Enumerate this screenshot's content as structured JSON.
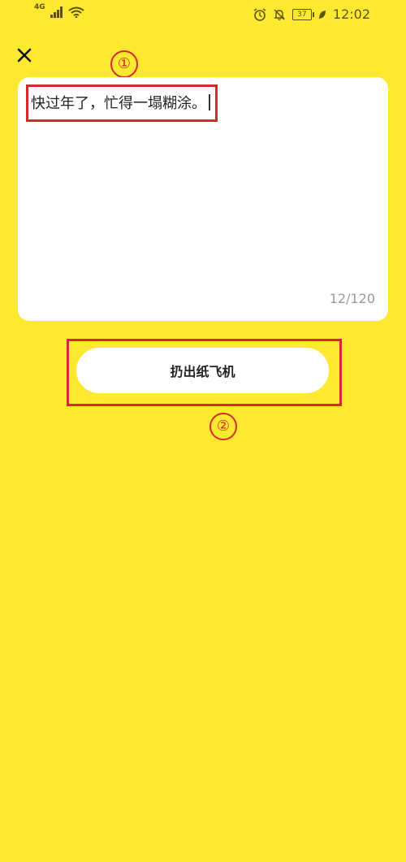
{
  "status_bar": {
    "network": "4G",
    "battery": "37",
    "time": "12:02"
  },
  "icons": {
    "close": "close-icon",
    "signal": "signal-icon",
    "wifi": "wifi-icon",
    "alarm": "alarm-icon",
    "mute": "bell-off-icon",
    "leaf": "leaf-icon"
  },
  "note": {
    "text": "快过年了，忙得一塌糊涂。",
    "char_count": "12/120"
  },
  "action": {
    "throw_label": "扔出纸飞机"
  },
  "annotations": {
    "marker_1": "①",
    "marker_2": "②"
  },
  "colors": {
    "background": "#fde92f",
    "card": "#ffffff",
    "annotation": "#d42a2a"
  }
}
